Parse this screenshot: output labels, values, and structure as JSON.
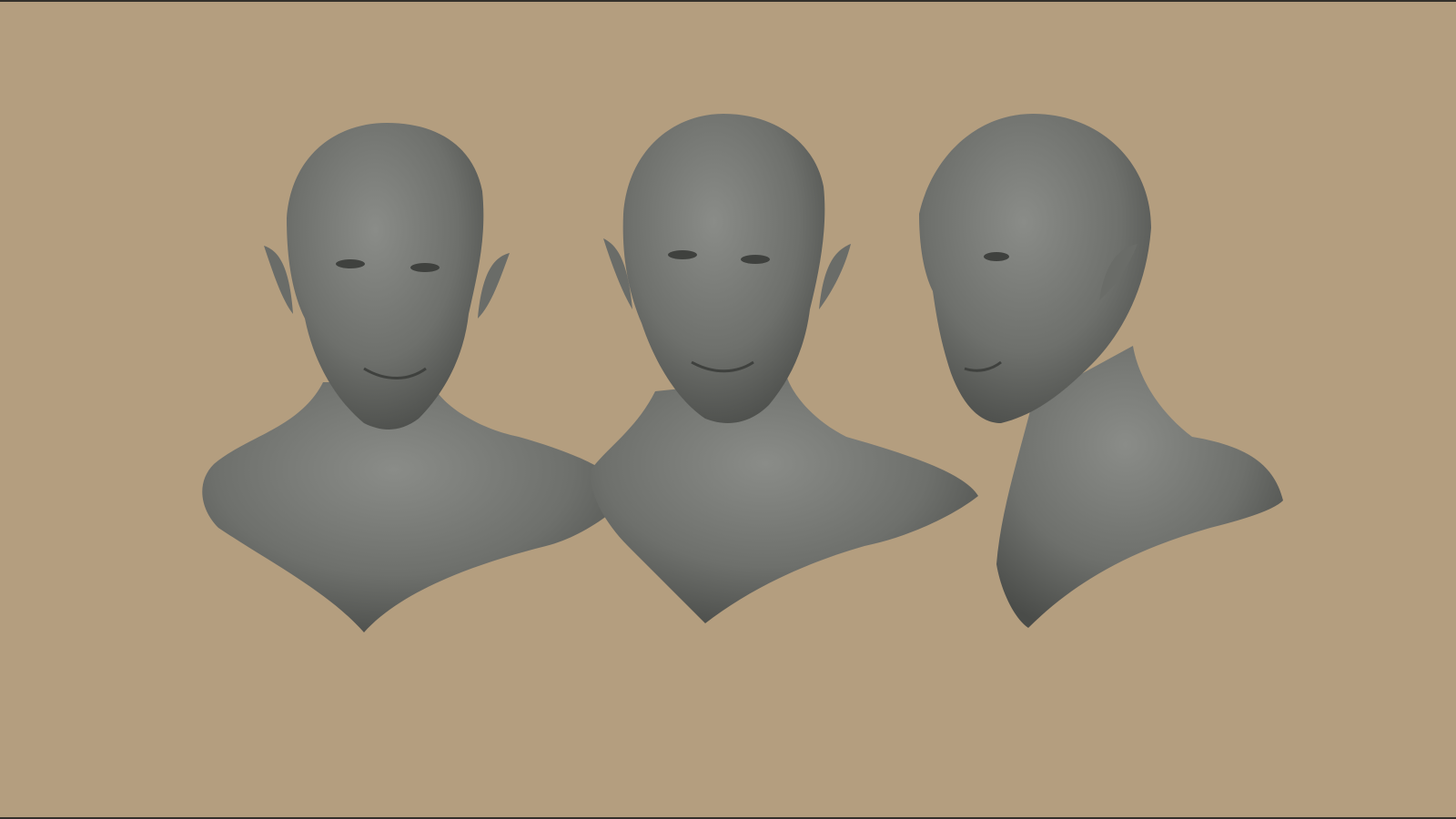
{
  "viewport": {
    "background_color": "#b49e7f",
    "frame_color": "#33302b",
    "model_color": "#6e706c",
    "model_highlight": "#8a8c88",
    "model_shadow": "#3f413e"
  },
  "busts": [
    {
      "view": "front"
    },
    {
      "view": "front-three-quarter"
    },
    {
      "view": "side-three-quarter"
    }
  ]
}
